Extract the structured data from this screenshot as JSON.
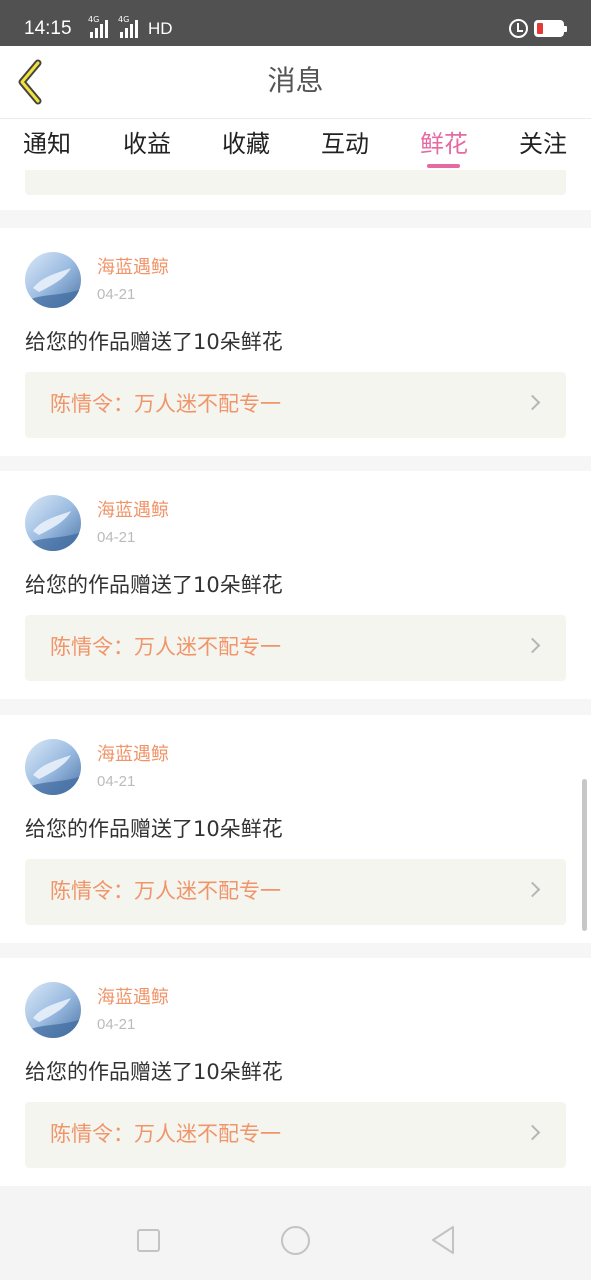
{
  "status_bar": {
    "time": "14:15",
    "network_1": "4G",
    "network_2": "4G",
    "hd": "HD",
    "alarm_icon": "alarm-icon",
    "battery_icon": "battery-low-icon",
    "battery_color": "#e53935"
  },
  "header": {
    "title": "消息",
    "back_icon": "chevron-left-icon"
  },
  "tabs": [
    {
      "label": "通知",
      "active": false
    },
    {
      "label": "收益",
      "active": false
    },
    {
      "label": "收藏",
      "active": false
    },
    {
      "label": "互动",
      "active": false
    },
    {
      "label": "鲜花",
      "active": true
    },
    {
      "label": "关注",
      "active": false
    }
  ],
  "colors": {
    "accent": "#e56aa2",
    "username": "#f0956a",
    "link_bg": "#f5f5ef"
  },
  "messages": [
    {
      "username": "海蓝遇鲸",
      "date": "04-21",
      "text": "给您的作品赠送了10朵鲜花",
      "work": "陈情令：万人迷不配专一"
    },
    {
      "username": "海蓝遇鲸",
      "date": "04-21",
      "text": "给您的作品赠送了10朵鲜花",
      "work": "陈情令：万人迷不配专一"
    },
    {
      "username": "海蓝遇鲸",
      "date": "04-21",
      "text": "给您的作品赠送了10朵鲜花",
      "work": "陈情令：万人迷不配专一"
    },
    {
      "username": "海蓝遇鲸",
      "date": "04-21",
      "text": "给您的作品赠送了10朵鲜花",
      "work": "陈情令：万人迷不配专一"
    }
  ],
  "nav_bar": {
    "recent_icon": "square-icon",
    "home_icon": "circle-icon",
    "back_icon": "triangle-back-icon"
  }
}
